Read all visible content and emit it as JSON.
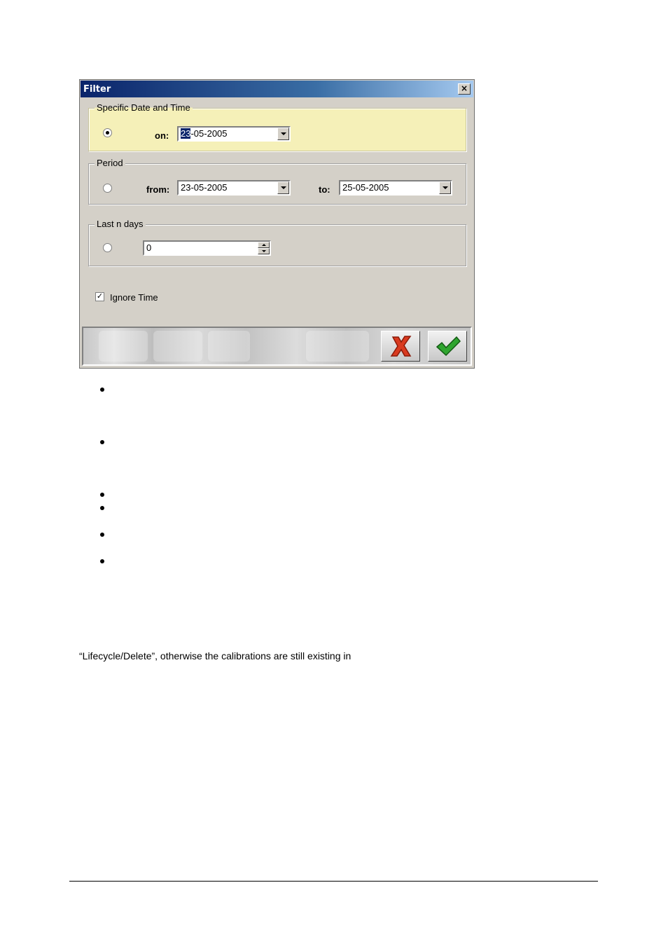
{
  "dialog": {
    "title": "Filter",
    "close_glyph": "×",
    "specific": {
      "legend": "Specific Date and Time",
      "on_label": "on:",
      "date_selected_part": "23",
      "date_rest": "-05-2005"
    },
    "period": {
      "legend": "Period",
      "from_label": "from:",
      "from_value": "23-05-2005",
      "to_label": "to:",
      "to_value": "25-05-2005"
    },
    "last_n_days": {
      "legend": "Last n days",
      "value": "0"
    },
    "ignore_time": {
      "label": "Ignore Time",
      "checked_glyph": "✓"
    },
    "buttons": {
      "cancel_icon": "red-x-icon",
      "ok_icon": "green-check-icon"
    }
  },
  "document": {
    "line": "“Lifecycle/Delete”, otherwise the calibrations are still existing in"
  }
}
